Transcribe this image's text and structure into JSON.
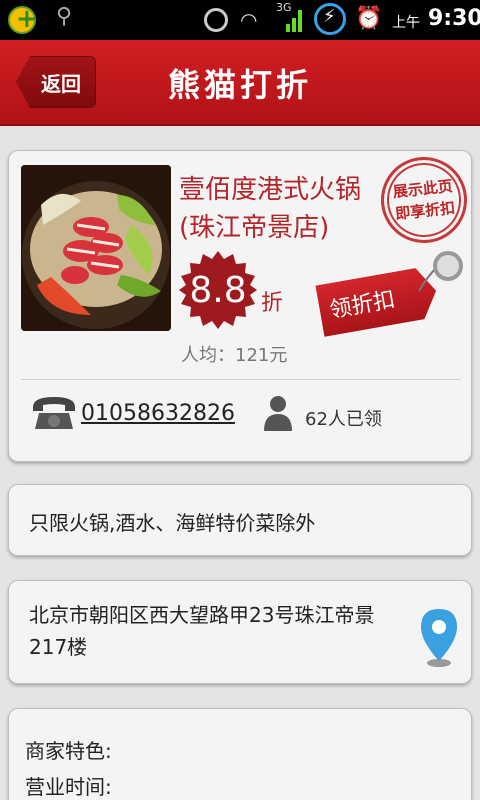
{
  "status_bar": {
    "ampm": "上午",
    "time": "9:30",
    "network": "3G"
  },
  "header": {
    "back_label": "返回",
    "title": "熊猫打折"
  },
  "deal": {
    "shop_name": "壹佰度港式火锅(珠江帝景店)",
    "stamp_line1": "展示此页",
    "stamp_line2": "即享折扣",
    "discount": "8.8",
    "discount_unit": "折",
    "avg_price": "人均：121元",
    "claim_button": "领折扣",
    "phone": "01058632826",
    "claimed_count": "62人已领"
  },
  "note": "只限火锅,酒水、海鲜特价菜除外",
  "address": "北京市朝阳区西大望路甲23号珠江帝景217楼",
  "info": {
    "features_label": "商家特色:",
    "hours_label": "营业时间:"
  },
  "colors": {
    "brand_red": "#c8191e",
    "text_red": "#b2262a"
  }
}
